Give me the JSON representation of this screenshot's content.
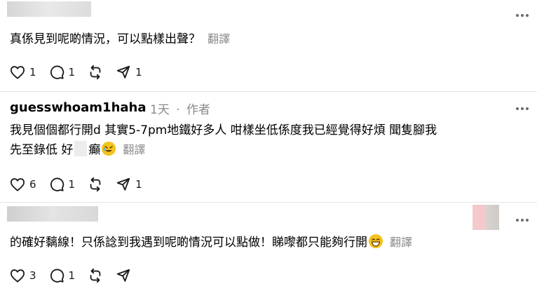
{
  "comment1": {
    "text": "真係見到呢啲情況，可以點樣出聲？",
    "translate": "翻譯",
    "like_count": "1",
    "reply_count": "1",
    "share_count": "1"
  },
  "comment2": {
    "username": "guesswhoam1haha",
    "time": "1天",
    "separator": "·",
    "author_tag": "作者",
    "line1": "我見個個都行開d 其實5-7pm地鐵好多人 咁樣坐低係度我已經覺得好煩 聞隻腳我",
    "line2a": "先至錄低 好",
    "line2b": "癲",
    "translate": "翻譯",
    "like_count": "6",
    "reply_count": "1",
    "share_count": "1"
  },
  "comment3": {
    "text": "的確好黐線！只係諗到我遇到呢啲情況可以點做！睇嚟都只能夠行開",
    "translate": "翻譯",
    "like_count": "3",
    "reply_count": "1"
  },
  "colors": {
    "text": "#000000",
    "muted": "#8a8a8a",
    "icon": "#1a1a1a",
    "emoji": "#f4c21b"
  }
}
